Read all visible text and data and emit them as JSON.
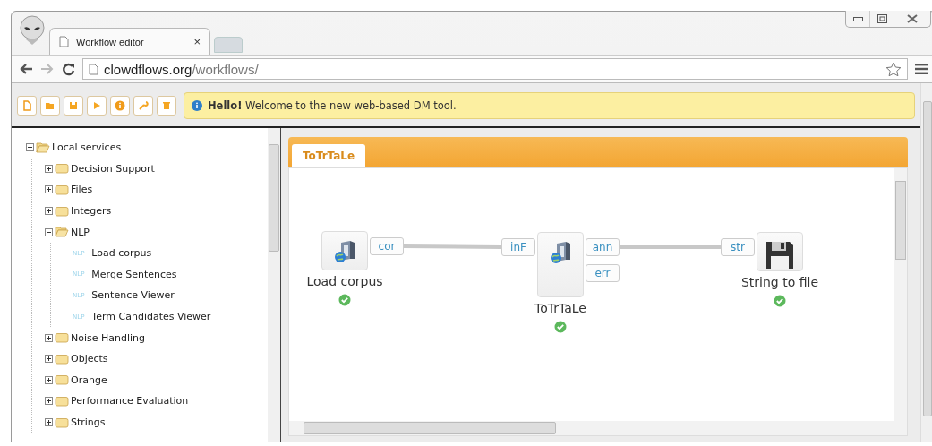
{
  "browser": {
    "tab_title": "Workflow editor",
    "tab_close": "×",
    "url_host": "clowdflows.org",
    "url_path": "/workflows/"
  },
  "alert": {
    "text": "**Hello!** Welcome to the new web-based DM tool."
  },
  "tree": [
    {
      "label": "Local services",
      "expanded": true,
      "children": [
        {
          "label": "Decision Support",
          "expanded": false
        },
        {
          "label": "Files",
          "expanded": false
        },
        {
          "label": "Integers",
          "expanded": false
        },
        {
          "label": "NLP",
          "expanded": true,
          "children": [
            {
              "label": "Load corpus",
              "badge": "NLP"
            },
            {
              "label": "Merge Sentences",
              "badge": "NLP"
            },
            {
              "label": "Sentence Viewer",
              "badge": "NLP"
            },
            {
              "label": "Term Candidates Viewer",
              "badge": "NLP"
            }
          ]
        },
        {
          "label": "Noise Handling",
          "expanded": false
        },
        {
          "label": "Objects",
          "expanded": false
        },
        {
          "label": "Orange",
          "expanded": false
        },
        {
          "label": "Performance Evaluation",
          "expanded": false
        },
        {
          "label": "Strings",
          "expanded": false
        }
      ]
    }
  ],
  "workflow_tabs": [
    {
      "label": "ToTrTaLe",
      "selected": true
    }
  ],
  "nodes": [
    {
      "name": "Load corpus",
      "kind": "service",
      "outputs": [
        {
          "label": "cor",
          "connected": true
        }
      ],
      "finished": true
    },
    {
      "name": "ToTrTaLe",
      "kind": "service",
      "inputs": [
        "inF"
      ],
      "outputs": [
        {
          "label": "ann",
          "connected": true
        },
        {
          "label": "err",
          "connected": false
        }
      ],
      "finished": true
    },
    {
      "name": "String to file",
      "kind": "save",
      "inputs": [
        "str"
      ],
      "finished": true
    }
  ]
}
